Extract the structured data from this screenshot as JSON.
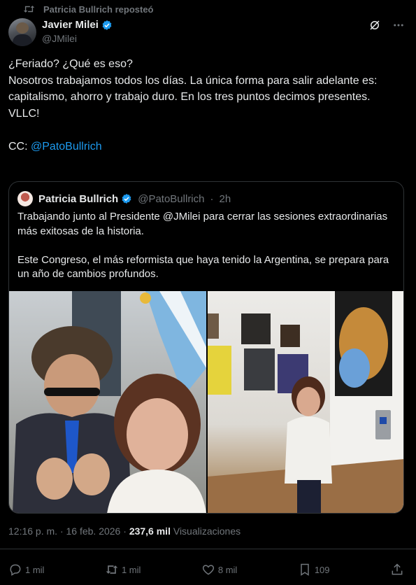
{
  "repost_line": {
    "text": "Patricia Bullrich reposteó",
    "icon": "repost-icon"
  },
  "author": {
    "name": "Javier Milei",
    "handle": "@JMilei",
    "verified": true
  },
  "post": {
    "line1": "¿Feriado? ¿Qué es eso?",
    "line2": "Nosotros trabajamos todos los días. La única forma para salir adelante es: capitalismo, ahorro y trabajo duro. En los tres puntos decimos presentes.",
    "line3": "VLLC!",
    "cc_prefix": "CC: ",
    "cc_mention": "@PatoBullrich"
  },
  "quote": {
    "name": "Patricia Bullrich",
    "handle": "@PatoBullrich",
    "time": "2h",
    "p1": "Trabajando junto al Presidente @JMilei para cerrar las sesiones extraordinarias más exitosas de la historia.",
    "p2": "Este Congreso, el más reformista que haya tenido la Argentina, se prepara para un año de cambios profundos."
  },
  "meta": {
    "time": "12:16 p. m.",
    "date": "16 feb. 2026",
    "views_count": "237,6 mil",
    "views_label": "Visualizaciones"
  },
  "actions": {
    "replies": "1 mil",
    "reposts": "1 mil",
    "likes": "8 mil",
    "bookmarks": "109"
  },
  "colors": {
    "link": "#1d9bf0",
    "muted": "#71767b",
    "text": "#e7e9ea",
    "background": "#000000",
    "border": "#2f3336"
  }
}
